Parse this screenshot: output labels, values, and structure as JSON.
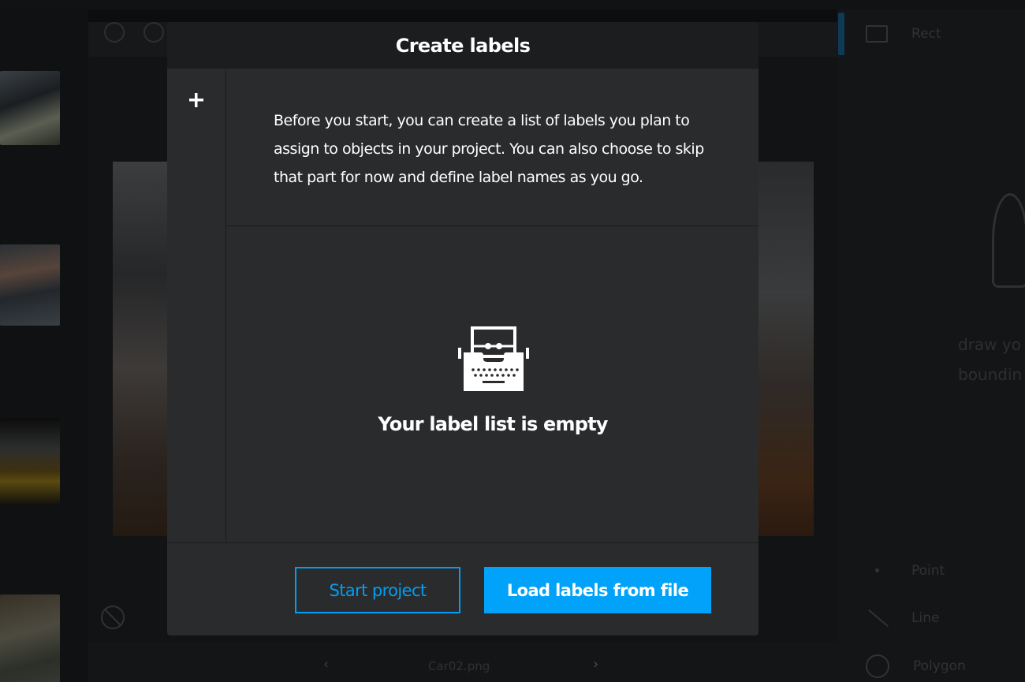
{
  "app": {
    "right_panel": {
      "tools": [
        {
          "label": "Rect",
          "icon": "rectangle-icon"
        },
        {
          "label": "Point",
          "icon": "point-icon"
        },
        {
          "label": "Line",
          "icon": "line-icon"
        },
        {
          "label": "Polygon",
          "icon": "polygon-icon"
        }
      ],
      "hint_line1": "draw yo",
      "hint_line2": "boundin"
    },
    "bottom_bar": {
      "file_name": "Car02.png",
      "prev_icon": "chevron-left-icon",
      "next_icon": "chevron-right-icon"
    }
  },
  "modal": {
    "title": "Create labels",
    "add_icon": "plus-icon",
    "intro_text": "Before you start, you can create a list of labels you plan to assign to objects in your project. You can also choose to skip that part for now and define label names as you go.",
    "empty_icon": "typewriter-icon",
    "empty_message": "Your label list is empty",
    "buttons": {
      "start": "Start project",
      "load": "Load labels from file"
    }
  },
  "colors": {
    "accent": "#00a2fa",
    "modal_bg": "#2a2b2c",
    "header_bg": "#1c1d1e",
    "backdrop": "#0c0d0e"
  }
}
